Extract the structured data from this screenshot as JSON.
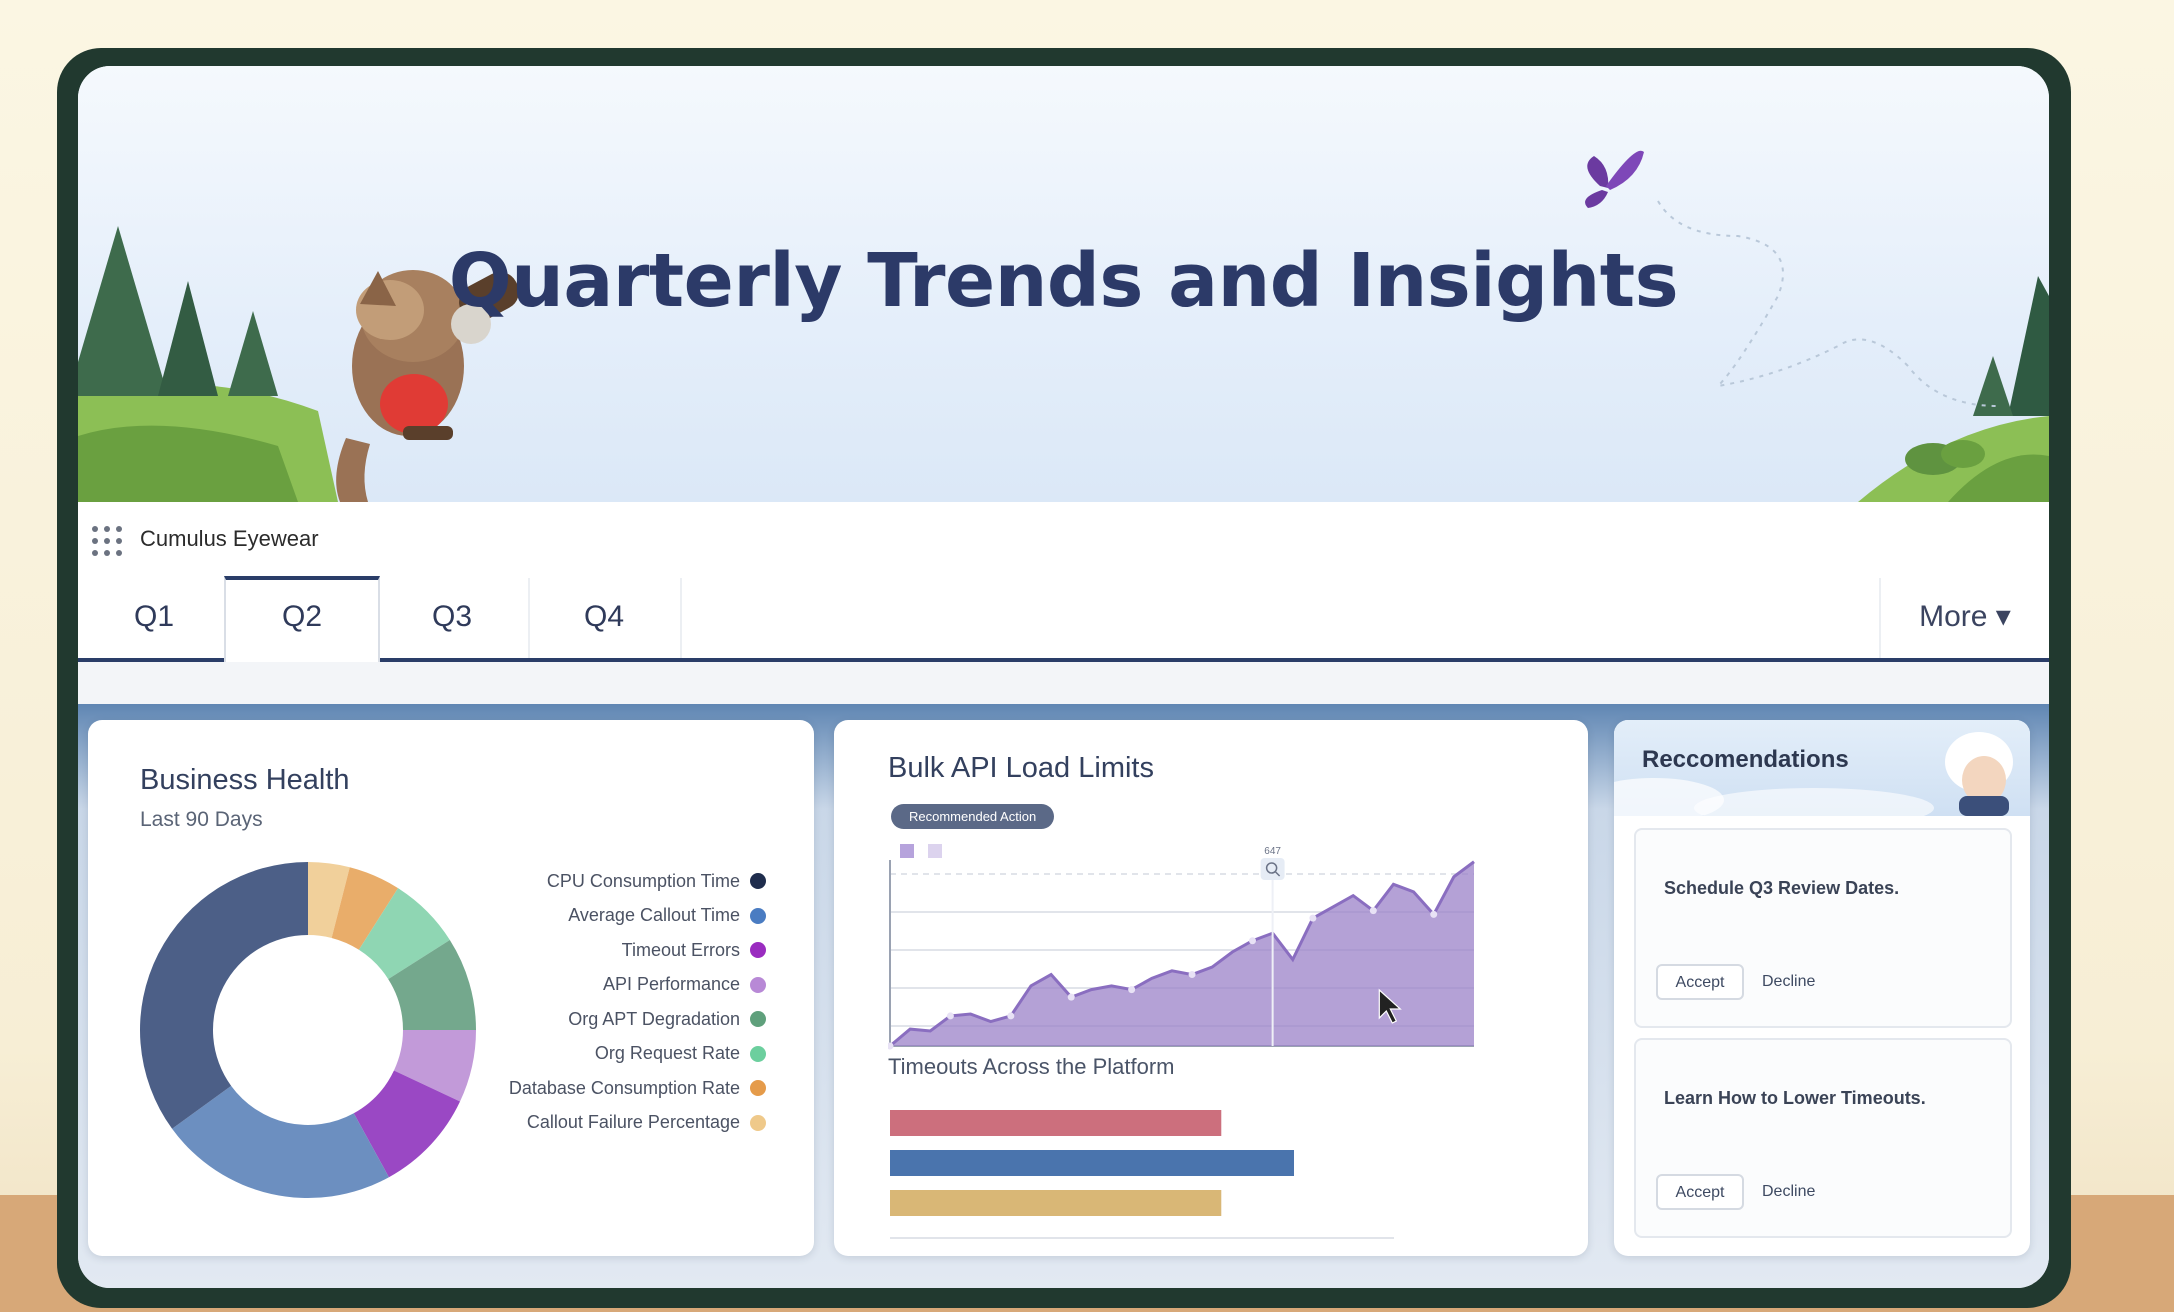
{
  "hero": {
    "title": "Quarterly Trends and Insights"
  },
  "app": {
    "name": "Cumulus Eyewear",
    "launcher_icon": "app-launcher-waffle-icon"
  },
  "tabs": [
    {
      "label": "Q1",
      "active": false
    },
    {
      "label": "Q2",
      "active": true
    },
    {
      "label": "Q3",
      "active": false
    },
    {
      "label": "Q4",
      "active": false
    }
  ],
  "more": {
    "label": "More ▾"
  },
  "business_health": {
    "title": "Business Health",
    "subtitle": "Last 90 Days",
    "legend": [
      {
        "label": "CPU Consumption Time",
        "color": "#1f2d4d"
      },
      {
        "label": "Average Callout Time",
        "color": "#4a7cc2"
      },
      {
        "label": "Timeout Errors",
        "color": "#9a2cc0"
      },
      {
        "label": "API Performance",
        "color": "#b889d6"
      },
      {
        "label": "Org APT Degradation",
        "color": "#5fa07c"
      },
      {
        "label": "Org Request Rate",
        "color": "#6ccf9e"
      },
      {
        "label": "Database Consumption Rate",
        "color": "#e59b4a"
      },
      {
        "label": "Callout Failure Percentage",
        "color": "#efc98a"
      }
    ]
  },
  "chart_data": [
    {
      "type": "pie",
      "title": "Business Health",
      "subtitle": "Last 90 Days",
      "donut": true,
      "slices": [
        {
          "label": "CPU Consumption Time",
          "value": 35,
          "color": "#4c5f87"
        },
        {
          "label": "Average Callout Time",
          "value": 23,
          "color": "#6c8fc0"
        },
        {
          "label": "Timeout Errors",
          "value": 10,
          "color": "#9a48c4"
        },
        {
          "label": "API Performance",
          "value": 7,
          "color": "#c29ad9"
        },
        {
          "label": "Org APT Degradation",
          "value": 9,
          "color": "#74a88d"
        },
        {
          "label": "Org Request Rate",
          "value": 7,
          "color": "#8fd6b3"
        },
        {
          "label": "Database Consumption Rate",
          "value": 5,
          "color": "#e9ad6a"
        },
        {
          "label": "Callout Failure Percentage",
          "value": 4,
          "color": "#f1d09b"
        }
      ]
    },
    {
      "type": "area",
      "title": "Bulk API Load Limits",
      "annotation": "Recommended Action",
      "point_label": "647",
      "x": [
        0,
        1,
        2,
        3,
        4,
        5,
        6,
        7,
        8,
        9,
        10,
        11,
        12,
        13,
        14,
        15,
        16,
        17,
        18,
        19,
        20,
        21,
        22,
        23,
        24,
        25,
        26,
        27,
        28,
        29
      ],
      "y": [
        0,
        90,
        80,
        160,
        170,
        130,
        160,
        320,
        380,
        260,
        300,
        320,
        300,
        360,
        400,
        380,
        420,
        500,
        560,
        600,
        460,
        680,
        740,
        800,
        720,
        860,
        820,
        700,
        900,
        980
      ],
      "ylim": [
        0,
        1000
      ],
      "color": "#9b82c8",
      "grid": true
    },
    {
      "type": "bar",
      "title": "Timeouts Across the Platform",
      "orientation": "horizontal",
      "categories": [
        "",
        "",
        ""
      ],
      "values": [
        82,
        100,
        82
      ],
      "colors": [
        "#cc6f7d",
        "#4a74ad",
        "#d9b776"
      ]
    }
  ],
  "bulk_api": {
    "title": "Bulk API Load Limits",
    "badge": "Recommended Action",
    "point_label": "647"
  },
  "timeouts": {
    "title": "Timeouts Across the Platform"
  },
  "recommendations": {
    "title": "Reccomendations",
    "items": [
      {
        "text": "Schedule Q3 Review Dates.",
        "accept": "Accept",
        "decline": "Decline"
      },
      {
        "text": "Learn How to Lower Timeouts.",
        "accept": "Accept",
        "decline": "Decline"
      }
    ]
  }
}
